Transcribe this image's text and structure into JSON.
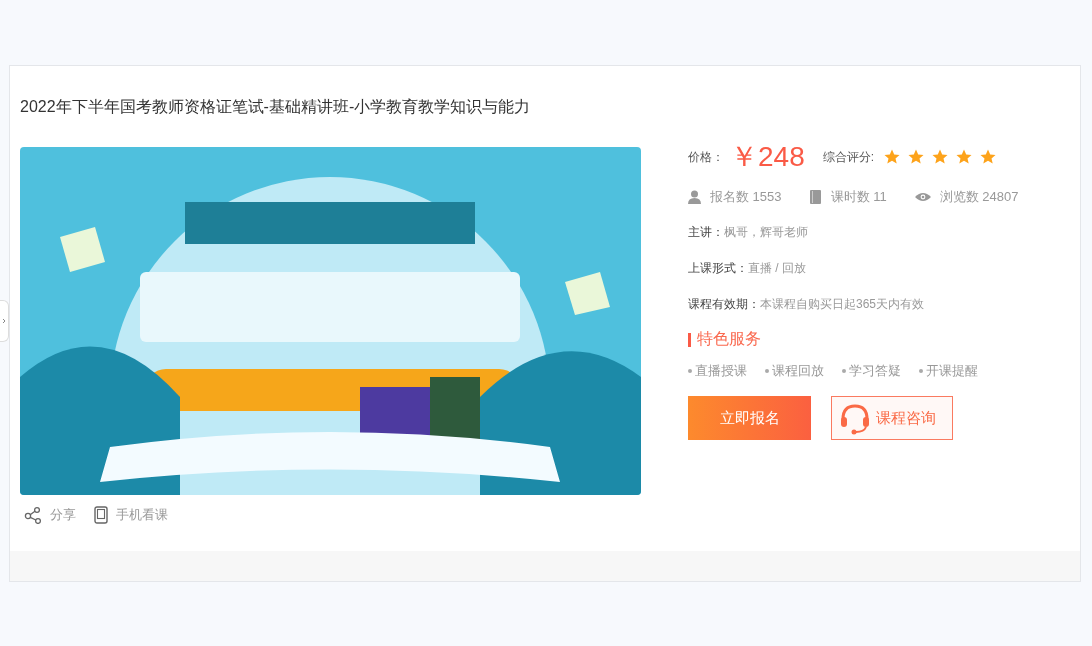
{
  "course": {
    "title": "2022年下半年国考教师资格证笔试-基础精讲班-小学教育教学知识与能力",
    "share": [
      {
        "kind": "share",
        "label": "分享"
      },
      {
        "kind": "phone",
        "label": "手机看课"
      }
    ],
    "price": {
      "label": "价格：",
      "value": "￥248"
    },
    "rating": {
      "label": "综合评分:",
      "stars": 5
    },
    "stats": [
      {
        "kind": "user",
        "text": "报名数 1553"
      },
      {
        "kind": "book",
        "text": "课时数 11"
      },
      {
        "kind": "eye",
        "text": "浏览数 24807"
      }
    ],
    "info": [
      {
        "label": "主讲：",
        "value": "枫哥，辉哥老师"
      },
      {
        "label": "上课形式：",
        "value": "直播 / 回放"
      },
      {
        "label": "课程有效期：",
        "value": "本课程自购买日起365天内有效"
      }
    ],
    "services_title": "特色服务",
    "services": [
      "直播授课",
      "课程回放",
      "学习答疑",
      "开课提醒"
    ],
    "buttons": [
      {
        "kind": "primary",
        "label": "立即报名"
      },
      {
        "kind": "consult",
        "label": "课程咨询"
      }
    ]
  }
}
